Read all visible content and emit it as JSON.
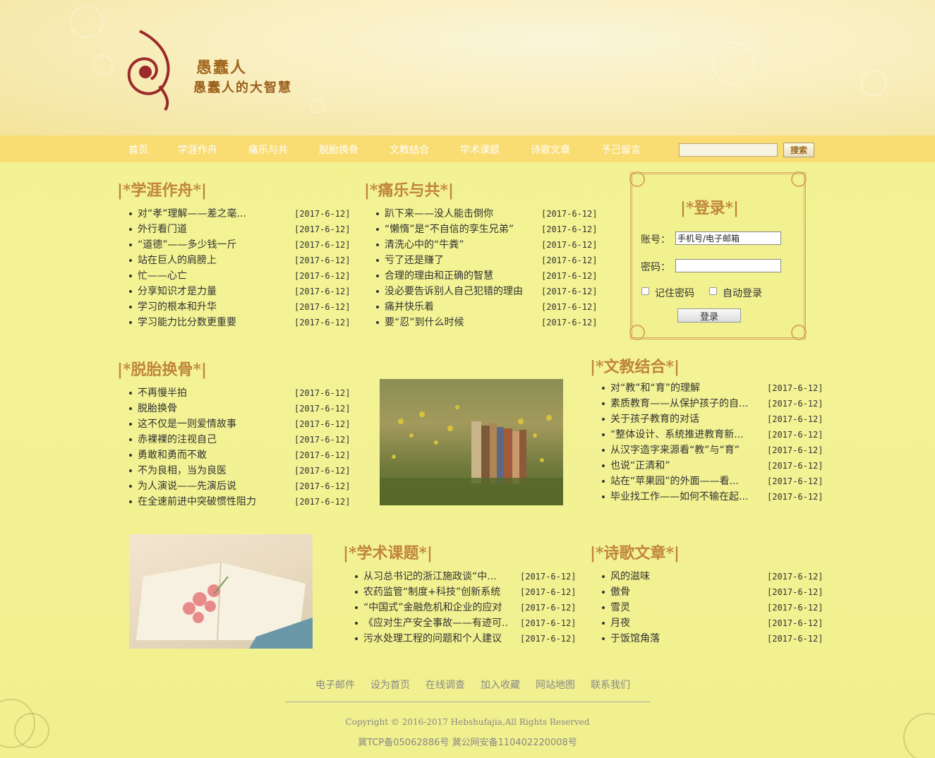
{
  "site": {
    "title": "愚蠢人",
    "slogan": "愚蠢人的大智慧"
  },
  "nav": {
    "items": [
      "首页",
      "学涯作舟",
      "痛乐与共",
      "脱胎换骨",
      "文教结合",
      "学术课题",
      "诗歌文章",
      "予己留言"
    ],
    "search_button": "搜索",
    "search_value": ""
  },
  "sections": {
    "xueya": {
      "title": "|*学涯作舟*|",
      "items": [
        {
          "t": "对“孝”理解——差之毫...",
          "d": "[2017-6-12]"
        },
        {
          "t": "外行看门道",
          "d": "[2017-6-12]"
        },
        {
          "t": "“道德”——多少钱一斤",
          "d": "[2017-6-12]"
        },
        {
          "t": "站在巨人的肩膀上",
          "d": "[2017-6-12]"
        },
        {
          "t": "忙——心亡",
          "d": "[2017-6-12]"
        },
        {
          "t": "分享知识才是力量",
          "d": "[2017-6-12]"
        },
        {
          "t": "学习的根本和升华",
          "d": "[2017-6-12]"
        },
        {
          "t": "学习能力比分数更重要",
          "d": "[2017-6-12]"
        }
      ]
    },
    "tongle": {
      "title": "|*痛乐与共*|",
      "items": [
        {
          "t": "趴下来——没人能击倒你",
          "d": "[2017-6-12]"
        },
        {
          "t": "“懒惰”是“不自信的孪生兄弟”",
          "d": "[2017-6-12]"
        },
        {
          "t": "清洗心中的“牛粪”",
          "d": "[2017-6-12]"
        },
        {
          "t": "亏了还是赚了",
          "d": "[2017-6-12]"
        },
        {
          "t": "合理的理由和正确的智慧",
          "d": "[2017-6-12]"
        },
        {
          "t": "没必要告诉别人自己犯错的理由",
          "d": "[2017-6-12]"
        },
        {
          "t": "痛并快乐着",
          "d": "[2017-6-12]"
        },
        {
          "t": "要“忍”到什么时候",
          "d": "[2017-6-12]"
        }
      ]
    },
    "tuotai": {
      "title": "|*脱胎换骨*|",
      "items": [
        {
          "t": "不再慢半拍",
          "d": "[2017-6-12]"
        },
        {
          "t": "脱胎换骨",
          "d": "[2017-6-12]"
        },
        {
          "t": "这不仅是一则爱情故事",
          "d": "[2017-6-12]"
        },
        {
          "t": "赤裸裸的注视自己",
          "d": "[2017-6-12]"
        },
        {
          "t": "勇敢和勇而不敢",
          "d": "[2017-6-12]"
        },
        {
          "t": "不为良相，当为良医",
          "d": "[2017-6-12]"
        },
        {
          "t": "为人演说——先演后说",
          "d": "[2017-6-12]"
        },
        {
          "t": "在全速前进中突破惯性阻力",
          "d": "[2017-6-12]"
        }
      ]
    },
    "wenjiao": {
      "title": "|*文教结合*|",
      "items": [
        {
          "t": "对“教”和“育”的理解",
          "d": "[2017-6-12]"
        },
        {
          "t": "素质教育——从保护孩子的自...",
          "d": "[2017-6-12]"
        },
        {
          "t": "关于孩子教育的对话",
          "d": "[2017-6-12]"
        },
        {
          "t": "“整体设计、系统推进教育新...",
          "d": "[2017-6-12]"
        },
        {
          "t": "从汉字造字来源看“教”与“育”",
          "d": "[2017-6-12]"
        },
        {
          "t": "也说“正清和”",
          "d": "[2017-6-12]"
        },
        {
          "t": "站在“苹果园”的外面——看...",
          "d": "[2017-6-12]"
        },
        {
          "t": "毕业找工作——如何不输在起...",
          "d": "[2017-6-12]"
        }
      ]
    },
    "xueshu": {
      "title": "|*学术课题*|",
      "items": [
        {
          "t": "从习总书记的浙江施政谈“中...",
          "d": "[2017-6-12]"
        },
        {
          "t": "农药监管“制度+科技”创新系统",
          "d": "[2017-6-12]"
        },
        {
          "t": "“中国式”金融危机和企业的应对",
          "d": "[2017-6-12]"
        },
        {
          "t": "《应对生产安全事故——有迹可..",
          "d": "[2017-6-12]"
        },
        {
          "t": "污水处理工程的问题和个人建议",
          "d": "[2017-6-12]"
        }
      ]
    },
    "shige": {
      "title": "|*诗歌文章*|",
      "items": [
        {
          "t": "风的滋味",
          "d": "[2017-6-12]"
        },
        {
          "t": "傲骨",
          "d": "[2017-6-12]"
        },
        {
          "t": "雪灵",
          "d": "[2017-6-12]"
        },
        {
          "t": "月夜",
          "d": "[2017-6-12]"
        },
        {
          "t": "于饭馆角落",
          "d": "[2017-6-12]"
        }
      ]
    }
  },
  "login": {
    "title": "|*登录*|",
    "account_label": "账号：",
    "account_value": "手机号/电子邮箱",
    "password_label": "密码：",
    "password_value": "",
    "remember_label": "记住密码",
    "auto_label": "自动登录",
    "submit": "登录"
  },
  "footer": {
    "links": [
      "电子邮件",
      "设为首页",
      "在线调查",
      "加入收藏",
      "网站地图",
      "联系我们"
    ],
    "copyright": "Copyright © 2016-2017 Hebshufajia,All Rights Reserved",
    "icp": "冀TCP备05062886号 冀公网安备110402220008号"
  },
  "colors": {
    "nav": "#f9dc72",
    "title": "#c0843b",
    "background": "#f2f28f"
  },
  "icons": [
    "logo-swirl-icon",
    "checkbox-icon"
  ]
}
